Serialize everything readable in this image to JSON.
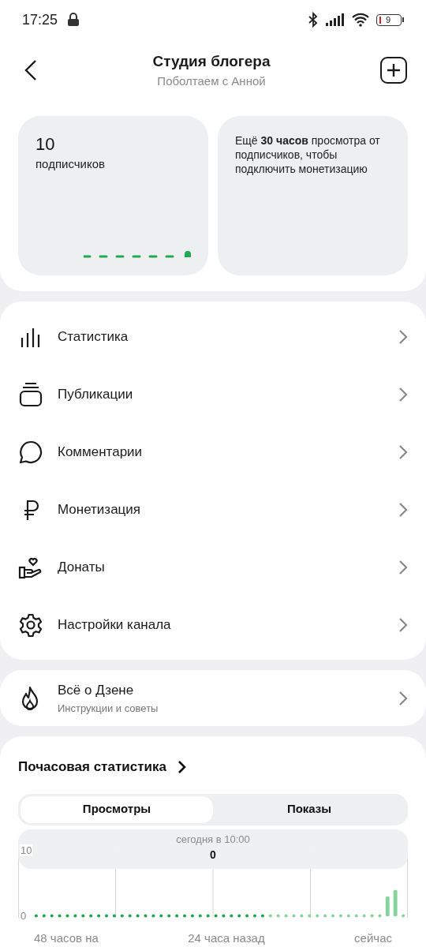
{
  "status_bar": {
    "time": "17:25",
    "battery": "9"
  },
  "header": {
    "title": "Студия блогера",
    "subtitle": "Поболтаем с Анной"
  },
  "cards": [
    {
      "value": "10",
      "label": "подписчиков"
    },
    {
      "text": "Ещё **30 часов** просмотра от подписчиков, чтобы подключить монетизацию"
    }
  ],
  "menu": [
    {
      "label": "Статистика"
    },
    {
      "label": "Публикации"
    },
    {
      "label": "Комментарии"
    },
    {
      "label": "Монетизация"
    },
    {
      "label": "Донаты"
    },
    {
      "label": "Настройки канала"
    }
  ],
  "about": {
    "title": "Всё о Дзене",
    "subtitle": "Инструкции и советы"
  },
  "hourly": {
    "title": "Почасовая статистика",
    "tabs": [
      {
        "label": "Просмотры",
        "selected": true
      },
      {
        "label": "Показы",
        "selected": false
      }
    ],
    "tooltip": {
      "time": "сегодня в 10:00",
      "value": "0"
    },
    "chart_data": {
      "type": "bar",
      "ylim": [
        0,
        10
      ],
      "yticks": [
        0,
        10
      ],
      "series": [
        {
          "color": "#1fa64a",
          "values": [
            0,
            0,
            0,
            0,
            0,
            0,
            0,
            0,
            0,
            0,
            0,
            0,
            0,
            0,
            0,
            0,
            0,
            0,
            0,
            0,
            0,
            0,
            0,
            0,
            0,
            0,
            0,
            0,
            0,
            0,
            null,
            null,
            null,
            null,
            null,
            null,
            null,
            null,
            null,
            null,
            null,
            null,
            null,
            null,
            null,
            null,
            null,
            null
          ]
        },
        {
          "color": "#85d49e",
          "values": [
            null,
            null,
            null,
            null,
            null,
            null,
            null,
            null,
            null,
            null,
            null,
            null,
            null,
            null,
            null,
            null,
            null,
            null,
            null,
            null,
            null,
            null,
            null,
            null,
            null,
            null,
            null,
            null,
            null,
            null,
            0,
            0,
            0,
            0,
            0,
            0,
            0,
            0,
            0,
            0,
            0,
            0,
            0,
            0,
            0,
            3,
            4,
            0
          ]
        }
      ]
    },
    "axis_labels": [
      "48 часов на",
      "24 часа назад",
      "сейчас"
    ]
  }
}
